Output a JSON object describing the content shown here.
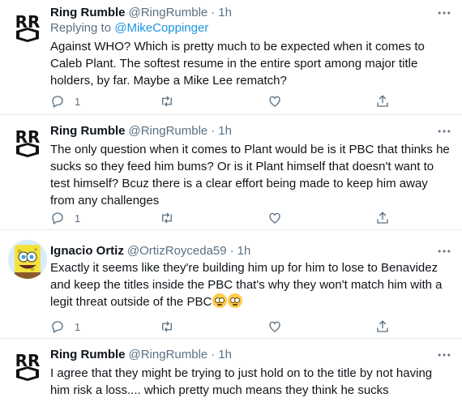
{
  "tweets": [
    {
      "display_name": "Ring Rumble",
      "handle": "@RingRumble",
      "separator": "·",
      "time": "1h",
      "reply_prefix": "Replying to",
      "reply_handle": "@MikeCoppinger",
      "text": "Against WHO? Which is pretty much to be expected when it comes to Caleb Plant. The softest resume in the entire sport among major title holders, by far. Maybe a Mike Lee rematch?",
      "reply_count": "1"
    },
    {
      "display_name": "Ring Rumble",
      "handle": "@RingRumble",
      "separator": "·",
      "time": "1h",
      "text": "The only question when it comes to Plant would be is it PBC that thinks he sucks so they feed him bums? Or is it Plant himself that doesn't want to test himself? Bcuz there is a clear effort being made to keep him away from any challenges",
      "reply_count": "1"
    },
    {
      "display_name": "Ignacio Ortiz",
      "handle": "@OrtizRoyceda59",
      "separator": "·",
      "time": "1h",
      "text": "Exactly it seems like they're building him up for him to lose to Benavidez and keep the titles inside the PBC that's why they won't match him with a legit threat outside of the PBC",
      "reply_count": "1"
    },
    {
      "display_name": "Ring Rumble",
      "handle": "@RingRumble",
      "separator": "·",
      "time": "1h",
      "text": "I agree that they might be trying to just hold on to the title by not having him risk a loss.... which pretty much means they think he sucks"
    }
  ],
  "avatar_logo_text": "RR",
  "colors": {
    "link": "#1b95e0",
    "secondary": "#5b7083",
    "divider": "#e6ecf0"
  }
}
